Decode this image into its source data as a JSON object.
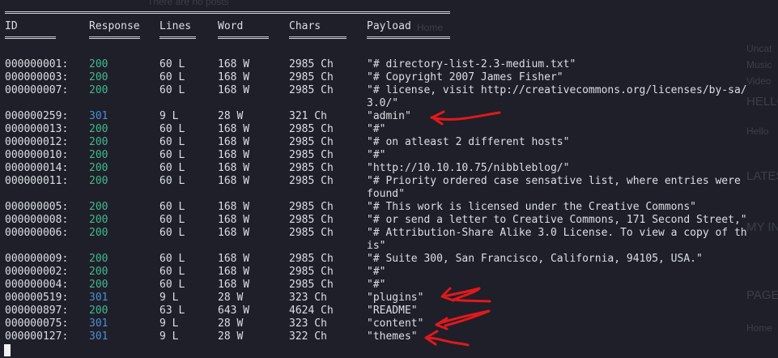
{
  "background_page": {
    "top_text": "There are no posts",
    "right_texts": [
      "Home",
      "Uncat",
      "Music",
      "Video",
      "HELLO",
      "Hello",
      "LATES",
      "MY IN",
      "PAGE",
      "Home"
    ]
  },
  "headers": {
    "id": "ID",
    "response": "Response",
    "lines": "Lines",
    "word": "Word",
    "chars": "Chars",
    "payload": "Payload"
  },
  "rows": [
    {
      "id": "000000001:",
      "response": "200",
      "lines": "60 L",
      "word": "168 W",
      "chars": "2985 Ch",
      "payload": "\"# directory-list-2.3-medium.txt\""
    },
    {
      "id": "000000003:",
      "response": "200",
      "lines": "60 L",
      "word": "168 W",
      "chars": "2985 Ch",
      "payload": "\"# Copyright 2007 James Fisher\""
    },
    {
      "id": "000000007:",
      "response": "200",
      "lines": "60 L",
      "word": "168 W",
      "chars": "2985 Ch",
      "payload": "\"# license, visit http://creativecommons.org/licenses/by-sa/",
      "payload_cont": "3.0/\""
    },
    {
      "id": "000000259:",
      "response": "301",
      "lines": "9 L",
      "word": "28 W",
      "chars": "321 Ch",
      "payload": "\"admin\""
    },
    {
      "id": "000000013:",
      "response": "200",
      "lines": "60 L",
      "word": "168 W",
      "chars": "2985 Ch",
      "payload": "\"#\""
    },
    {
      "id": "000000012:",
      "response": "200",
      "lines": "60 L",
      "word": "168 W",
      "chars": "2985 Ch",
      "payload": "\"# on atleast 2 different hosts\""
    },
    {
      "id": "000000010:",
      "response": "200",
      "lines": "60 L",
      "word": "168 W",
      "chars": "2985 Ch",
      "payload": "\"#\""
    },
    {
      "id": "000000014:",
      "response": "200",
      "lines": "60 L",
      "word": "168 W",
      "chars": "2985 Ch",
      "payload": "\"http://10.10.10.75/nibbleblog/\""
    },
    {
      "id": "000000011:",
      "response": "200",
      "lines": "60 L",
      "word": "168 W",
      "chars": "2985 Ch",
      "payload": "\"# Priority ordered case sensative list, where entries were",
      "payload_cont": "found\""
    },
    {
      "id": "000000005:",
      "response": "200",
      "lines": "60 L",
      "word": "168 W",
      "chars": "2985 Ch",
      "payload": "\"# This work is licensed under the Creative Commons\""
    },
    {
      "id": "000000008:",
      "response": "200",
      "lines": "60 L",
      "word": "168 W",
      "chars": "2985 Ch",
      "payload": "\"# or send a letter to Creative Commons, 171 Second Street,\""
    },
    {
      "id": "000000006:",
      "response": "200",
      "lines": "60 L",
      "word": "168 W",
      "chars": "2985 Ch",
      "payload": "\"# Attribution-Share Alike 3.0 License. To view a copy of th",
      "payload_cont": "is\""
    },
    {
      "id": "000000009:",
      "response": "200",
      "lines": "60 L",
      "word": "168 W",
      "chars": "2985 Ch",
      "payload": "\"# Suite 300, San Francisco, California, 94105, USA.\""
    },
    {
      "id": "000000002:",
      "response": "200",
      "lines": "60 L",
      "word": "168 W",
      "chars": "2985 Ch",
      "payload": "\"#\""
    },
    {
      "id": "000000004:",
      "response": "200",
      "lines": "60 L",
      "word": "168 W",
      "chars": "2985 Ch",
      "payload": "\"#\""
    },
    {
      "id": "000000519:",
      "response": "301",
      "lines": "9 L",
      "word": "28 W",
      "chars": "323 Ch",
      "payload": "\"plugins\""
    },
    {
      "id": "000000897:",
      "response": "200",
      "lines": "63 L",
      "word": "643 W",
      "chars": "4624 Ch",
      "payload": "\"README\""
    },
    {
      "id": "000000075:",
      "response": "301",
      "lines": "9 L",
      "word": "28 W",
      "chars": "323 Ch",
      "payload": "\"content\""
    },
    {
      "id": "000000127:",
      "response": "301",
      "lines": "9 L",
      "word": "28 W",
      "chars": "322 Ch",
      "payload": "\"themes\""
    }
  ],
  "colors": {
    "background": "#1e1f29",
    "text": "#dcdfe4",
    "status_200": "#42b98f",
    "status_301": "#4c8fd6",
    "annotation_arrow": "#e0191b"
  }
}
